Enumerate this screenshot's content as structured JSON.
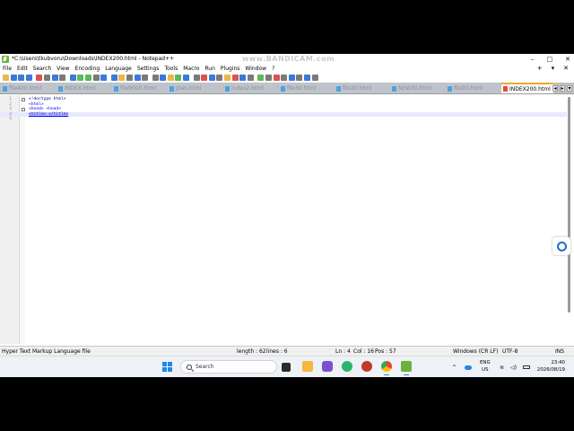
{
  "window": {
    "title": "*C:\\Users\\tkubvoru\\Downloads\\INDEX200.html - Notepad++",
    "watermark": "www.BANDICAM.com",
    "controls": [
      "–",
      "□",
      "✕"
    ]
  },
  "menubar": {
    "items": [
      "File",
      "Edit",
      "Search",
      "View",
      "Encoding",
      "Language",
      "Settings",
      "Tools",
      "Macro",
      "Run",
      "Plugins",
      "Window",
      "?"
    ],
    "right": [
      "+",
      "▾",
      "✕"
    ]
  },
  "toolbar": {
    "colors": [
      "#e8b84a",
      "#3a7bd5",
      "#3a7bd5",
      "#3a7bd5",
      "#d9534f",
      "#7a7a7a",
      "#3a7bd5",
      "#7a7a7a",
      "#3a7bd5",
      "#5cb85c",
      "#5cb85c",
      "#7a7a7a",
      "#3a7bd5",
      "#3a7bd5",
      "#e8b84a",
      "#7a7a7a",
      "#3a7bd5",
      "#7a7a7a",
      "#7a7a7a",
      "#3a7bd5",
      "#e8b84a",
      "#5cb85c",
      "#3a7bd5",
      "#7a7a7a",
      "#d9534f",
      "#3a7bd5",
      "#7a7a7a",
      "#e8b84a",
      "#d9534f",
      "#3a7bd5",
      "#7a7a7a",
      "#5cb85c",
      "#7a7a7a",
      "#d9534f",
      "#7a7a7a",
      "#3a7bd5",
      "#7a7a7a",
      "#3a7bd5",
      "#7a7a7a"
    ]
  },
  "tabs": [
    {
      "label": "file400.html",
      "active": false
    },
    {
      "label": "INDEX.html",
      "active": false
    },
    {
      "label": "file9000.html",
      "active": false
    },
    {
      "label": "plan.html",
      "active": false
    },
    {
      "label": "index2.html",
      "active": false
    },
    {
      "label": "file30.html",
      "active": false
    },
    {
      "label": "file20.html",
      "active": false
    },
    {
      "label": "NEW30.html",
      "active": false
    },
    {
      "label": "file90.html",
      "active": false
    },
    {
      "label": "INDEX200.html",
      "active": true
    }
  ],
  "tab_nav": [
    "◂",
    "▸",
    "▾"
  ],
  "editor": {
    "lines": [
      {
        "num": "1",
        "parts": [
          {
            "t": "<!doctype html>",
            "c": "dt"
          }
        ]
      },
      {
        "num": "2",
        "parts": [
          {
            "t": "<html>",
            "c": "tag"
          }
        ]
      },
      {
        "num": "3",
        "parts": [
          {
            "t": "<head> <head>",
            "c": "tag"
          }
        ]
      },
      {
        "num": "4",
        "parts": [
          {
            "t": "<title> </title>",
            "c": "sel"
          }
        ]
      },
      {
        "num": "5",
        "parts": [
          {
            "t": "",
            "c": ""
          }
        ]
      }
    ],
    "current_line": 3
  },
  "statusbar": {
    "language": "Hyper Text Markup Language file",
    "length": "length : 62",
    "lines": "lines : 6",
    "ln": "Ln : 4",
    "col": "Col : 16",
    "pos": "Pos : 57",
    "eol": "Windows (CR LF)",
    "encoding": "UTF-8",
    "mode": "INS"
  },
  "taskbar": {
    "search_placeholder": "Search",
    "lang_top": "ENG",
    "lang_bottom": "US",
    "time": "23:40",
    "date": "2026/08/19",
    "tray_icons": [
      "chevron-up-icon",
      "cloud-icon",
      "network-icon",
      "volume-icon",
      "battery-icon"
    ]
  }
}
